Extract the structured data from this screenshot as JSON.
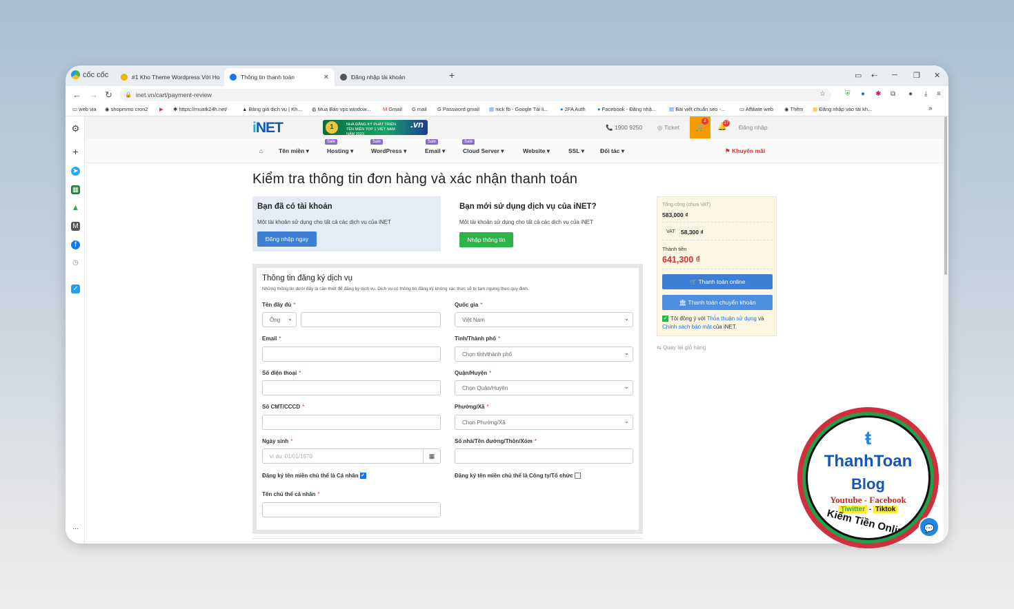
{
  "browser": {
    "brand": "cốc cốc",
    "tabs": [
      {
        "title": "#1 Kho Theme Wordpress Với Ho"
      },
      {
        "title": "Thông tin thanh toán"
      },
      {
        "title": "Đăng nhập tài khoản"
      }
    ],
    "new_tab": "+",
    "url": "inet.vn/cart/payment-review",
    "bookmarks": [
      "web via",
      "shopmmo cron2",
      "https://muatk24h.net/",
      "Bảng giá dịch vụ | Kh...",
      "Mua Bán vps window...",
      "Gmail",
      "mail",
      "Password gmail",
      "nick fb - Google Tài li...",
      "2FA Auth",
      "Facebook - Đăng nhậ...",
      "Bài viết chuẩn seo -...",
      "Affiliate web",
      "Thêm",
      "Đăng nhập vào tài kh..."
    ],
    "bookmarks_more": "»",
    "sidebar_more": "..."
  },
  "site": {
    "logo_i": "i",
    "logo_rest": "NET",
    "banner_text": "NHÀ ĐĂNG KÝ PHÁT TRIỂN TÊN MIỀN TOP 1 VIỆT NAM NĂM 2023",
    "banner_vn": ".vn",
    "phone": "1900 9250",
    "ticket": "Ticket",
    "cart_count": "2",
    "notif_count": "17",
    "login": "Đăng nhập",
    "menu": [
      {
        "label": "Tên miền ▾",
        "sale": ""
      },
      {
        "label": "Hosting ▾",
        "sale": "Sale"
      },
      {
        "label": "WordPress ▾",
        "sale": "Sale"
      },
      {
        "label": "Email ▾",
        "sale": "Sale"
      },
      {
        "label": "Cloud Server ▾",
        "sale": "Sale"
      },
      {
        "label": "Website ▾",
        "sale": ""
      },
      {
        "label": "SSL ▾",
        "sale": ""
      },
      {
        "label": "Đối tác ▾",
        "sale": ""
      }
    ],
    "promo": "Khuyến mãi"
  },
  "page": {
    "title": "Kiểm tra thông tin đơn hàng và xác nhận thanh toán",
    "have_account": {
      "title": "Bạn đã có tài khoản",
      "desc": "Một tài khoản sử dụng cho tất cả các dịch vụ của iNET",
      "button": "Đăng nhập ngay"
    },
    "new_user": {
      "title": "Bạn mới sử dụng dịch vụ của iNET?",
      "desc": "Một tài khoản sử dụng cho tất cả các dịch vụ của iNET",
      "button": "Nhập thông tin"
    }
  },
  "form": {
    "title": "Thông tin đăng ký dịch vụ",
    "desc": "Những thông tin dưới đây là cần thiết để đăng ký dịch vụ. Dịch vụ có thông tin đăng ký không xác thực sẽ bị tạm ngưng theo quy định.",
    "required_mark": "*",
    "full_name": {
      "label": "Tên đầy đủ",
      "title_value": "Ông",
      "value": ""
    },
    "email": {
      "label": "Email",
      "value": ""
    },
    "phone": {
      "label": "Số điện thoại",
      "value": ""
    },
    "id_number": {
      "label": "Số CMT/CCCD",
      "value": ""
    },
    "birthday": {
      "label": "Ngày sinh",
      "placeholder": "ví dụ: 01/01/1970"
    },
    "personal_owner": {
      "label": "Đăng ký tên miền chủ thể là Cá nhân",
      "checked": true
    },
    "owner_name": {
      "label": "Tên chủ thể cá nhân",
      "value": ""
    },
    "country": {
      "label": "Quốc gia",
      "value": "Việt Nam"
    },
    "province": {
      "label": "Tỉnh/Thành phố",
      "value": "Chọn tỉnh/thành phố"
    },
    "district": {
      "label": "Quận/Huyện",
      "value": "Chọn Quận/Huyện"
    },
    "ward": {
      "label": "Phường/Xã",
      "value": "Chọn Phường/Xã"
    },
    "address": {
      "label": "Số nhà/Tên đường/Thôn/Xóm",
      "value": ""
    },
    "company_owner": {
      "label": "Đăng ký tên miền chủ thể là Công ty/Tổ chức",
      "checked": false
    }
  },
  "summary": {
    "subtotal_label": "Tổng cộng (chưa VAT)",
    "subtotal": "583,000 ₫",
    "vat_label": "VAT",
    "vat": "58,300 ₫",
    "total_label": "Thành tiền",
    "total": "641,300 ₫",
    "pay_online": "Thanh toán online",
    "pay_transfer": "Thanh toán chuyển khoản",
    "agree_prefix": "Tôi đồng ý với",
    "terms": "Thỏa thuận sử dụng",
    "and": "và",
    "privacy": "Chính sách bảo mật",
    "agree_suffix": "của iNET.",
    "back": "Quay lại giỏ hàng"
  },
  "watermark": {
    "line1": "ThanhToan",
    "line2": "Blog",
    "line3": "Youtube - Facebook",
    "line4a": "Tiwitter",
    "line4b": "Tiktok",
    "line5": "Kiếm Tiền Online"
  },
  "colors": {
    "brand_blue": "#1457b8",
    "button_blue": "#3d7fd4",
    "button_green": "#2eb34a",
    "price_red": "#d32f2f",
    "cart_orange": "#f59b00"
  }
}
